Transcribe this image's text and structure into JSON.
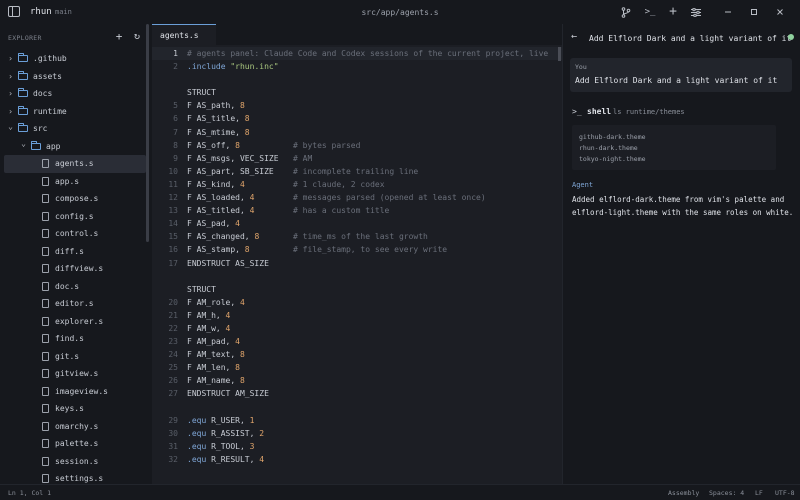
{
  "titlebar": {
    "app_name": "rhun",
    "branch": "main",
    "path": "src/app/agents.s",
    "icons": [
      "branch-icon",
      "terminal-icon",
      "plus-icon",
      "settings-sliders-icon",
      "minimize-icon",
      "maximize-icon",
      "close-icon"
    ]
  },
  "explorer": {
    "heading": "EXPLORER",
    "tree": [
      {
        "label": ".github",
        "kind": "folder",
        "depth": 0,
        "open": false
      },
      {
        "label": "assets",
        "kind": "folder",
        "depth": 0,
        "open": false
      },
      {
        "label": "docs",
        "kind": "folder",
        "depth": 0,
        "open": false
      },
      {
        "label": "runtime",
        "kind": "folder",
        "depth": 0,
        "open": false
      },
      {
        "label": "src",
        "kind": "folder",
        "depth": 0,
        "open": true
      },
      {
        "label": "app",
        "kind": "folder",
        "depth": 1,
        "open": true
      },
      {
        "label": "agents.s",
        "kind": "file",
        "depth": 2,
        "active": true
      },
      {
        "label": "app.s",
        "kind": "file",
        "depth": 2
      },
      {
        "label": "compose.s",
        "kind": "file",
        "depth": 2
      },
      {
        "label": "config.s",
        "kind": "file",
        "depth": 2
      },
      {
        "label": "control.s",
        "kind": "file",
        "depth": 2
      },
      {
        "label": "diff.s",
        "kind": "file",
        "depth": 2
      },
      {
        "label": "diffview.s",
        "kind": "file",
        "depth": 2
      },
      {
        "label": "doc.s",
        "kind": "file",
        "depth": 2
      },
      {
        "label": "editor.s",
        "kind": "file",
        "depth": 2
      },
      {
        "label": "explorer.s",
        "kind": "file",
        "depth": 2
      },
      {
        "label": "find.s",
        "kind": "file",
        "depth": 2
      },
      {
        "label": "git.s",
        "kind": "file",
        "depth": 2
      },
      {
        "label": "gitview.s",
        "kind": "file",
        "depth": 2
      },
      {
        "label": "imageview.s",
        "kind": "file",
        "depth": 2
      },
      {
        "label": "keys.s",
        "kind": "file",
        "depth": 2
      },
      {
        "label": "omarchy.s",
        "kind": "file",
        "depth": 2
      },
      {
        "label": "palette.s",
        "kind": "file",
        "depth": 2
      },
      {
        "label": "session.s",
        "kind": "file",
        "depth": 2
      },
      {
        "label": "settings.s",
        "kind": "file",
        "depth": 2
      }
    ]
  },
  "editor": {
    "tab_label": "agents.s",
    "lines": [
      {
        "n": "1",
        "segments": [
          [
            "cm",
            "# agents panel: Claude Code and Codex sessions of the current project, live"
          ]
        ],
        "current": true
      },
      {
        "n": "2",
        "segments": [
          [
            "dir",
            ".include "
          ],
          [
            "str",
            "\"rhun.inc\""
          ]
        ]
      },
      {
        "n": "",
        "segments": []
      },
      {
        "n": "",
        "segments": [
          [
            "txt",
            "STRUCT"
          ]
        ]
      },
      {
        "n": "5",
        "segments": [
          [
            "txt",
            "F AS_path, "
          ],
          [
            "num",
            "8"
          ]
        ]
      },
      {
        "n": "6",
        "segments": [
          [
            "txt",
            "F AS_title, "
          ],
          [
            "num",
            "8"
          ]
        ]
      },
      {
        "n": "7",
        "segments": [
          [
            "txt",
            "F AS_mtime, "
          ],
          [
            "num",
            "8"
          ]
        ]
      },
      {
        "n": "8",
        "segments": [
          [
            "txt",
            "F AS_off, "
          ],
          [
            "num",
            "8"
          ]
        ],
        "comment": "# bytes parsed"
      },
      {
        "n": "9",
        "segments": [
          [
            "txt",
            "F AS_msgs, VEC_SIZE"
          ]
        ],
        "comment": "# AM"
      },
      {
        "n": "10",
        "segments": [
          [
            "txt",
            "F AS_part, SB_SIZE"
          ]
        ],
        "comment": "# incomplete trailing line"
      },
      {
        "n": "11",
        "segments": [
          [
            "txt",
            "F AS_kind, "
          ],
          [
            "num",
            "4"
          ]
        ],
        "comment": "# 1 claude, 2 codex"
      },
      {
        "n": "12",
        "segments": [
          [
            "txt",
            "F AS_loaded, "
          ],
          [
            "num",
            "4"
          ]
        ],
        "comment": "# messages parsed (opened at least once)"
      },
      {
        "n": "13",
        "segments": [
          [
            "txt",
            "F AS_titled, "
          ],
          [
            "num",
            "4"
          ]
        ],
        "comment": "# has a custom title"
      },
      {
        "n": "14",
        "segments": [
          [
            "txt",
            "F AS_pad, "
          ],
          [
            "num",
            "4"
          ]
        ]
      },
      {
        "n": "15",
        "segments": [
          [
            "txt",
            "F AS_changed, "
          ],
          [
            "num",
            "8"
          ]
        ],
        "comment": "# time_ms of the last growth"
      },
      {
        "n": "16",
        "segments": [
          [
            "txt",
            "F AS_stamp, "
          ],
          [
            "num",
            "8"
          ]
        ],
        "comment": "# file_stamp, to see every write"
      },
      {
        "n": "17",
        "segments": [
          [
            "txt",
            "ENDSTRUCT AS_SIZE"
          ]
        ]
      },
      {
        "n": "",
        "segments": []
      },
      {
        "n": "",
        "segments": [
          [
            "txt",
            "STRUCT"
          ]
        ]
      },
      {
        "n": "20",
        "segments": [
          [
            "txt",
            "F AM_role, "
          ],
          [
            "num",
            "4"
          ]
        ]
      },
      {
        "n": "21",
        "segments": [
          [
            "txt",
            "F AM_h, "
          ],
          [
            "num",
            "4"
          ]
        ]
      },
      {
        "n": "22",
        "segments": [
          [
            "txt",
            "F AM_w, "
          ],
          [
            "num",
            "4"
          ]
        ]
      },
      {
        "n": "23",
        "segments": [
          [
            "txt",
            "F AM_pad, "
          ],
          [
            "num",
            "4"
          ]
        ]
      },
      {
        "n": "24",
        "segments": [
          [
            "txt",
            "F AM_text, "
          ],
          [
            "num",
            "8"
          ]
        ]
      },
      {
        "n": "25",
        "segments": [
          [
            "txt",
            "F AM_len, "
          ],
          [
            "num",
            "8"
          ]
        ]
      },
      {
        "n": "26",
        "segments": [
          [
            "txt",
            "F AM_name, "
          ],
          [
            "num",
            "8"
          ]
        ]
      },
      {
        "n": "27",
        "segments": [
          [
            "txt",
            "ENDSTRUCT AM_SIZE"
          ]
        ]
      },
      {
        "n": "",
        "segments": []
      },
      {
        "n": "29",
        "segments": [
          [
            "dir",
            ".equ "
          ],
          [
            "txt",
            "R_USER, "
          ],
          [
            "num",
            "1"
          ]
        ]
      },
      {
        "n": "30",
        "segments": [
          [
            "dir",
            ".equ "
          ],
          [
            "txt",
            "R_ASSIST, "
          ],
          [
            "num",
            "2"
          ]
        ]
      },
      {
        "n": "31",
        "segments": [
          [
            "dir",
            ".equ "
          ],
          [
            "txt",
            "R_TOOL, "
          ],
          [
            "num",
            "3"
          ]
        ]
      },
      {
        "n": "32",
        "segments": [
          [
            "dir",
            ".equ "
          ],
          [
            "txt",
            "R_RESULT, "
          ],
          [
            "num",
            "4"
          ]
        ]
      }
    ]
  },
  "agent": {
    "title": "Add Elflord Dark and a light variant of it",
    "you_label": "You",
    "you_message": "Add Elflord Dark and a light variant of it",
    "shell_label": "shell",
    "shell_command": "ls runtime/themes",
    "shell_output": [
      "github-dark.theme",
      "rhun-dark.theme",
      "tokyo-night.theme"
    ],
    "agent_label": "Agent",
    "agent_reply": "Added elflord-dark.theme from vim's palette and elflord-light.theme with the same roles on white.",
    "status_color": "#8fd19e"
  },
  "statusbar": {
    "cursor": "Ln 1, Col 1",
    "language": "Assembly",
    "indent": "Spaces: 4",
    "eol": "LF",
    "encoding": "UTF-8"
  },
  "colors": {
    "accent": "#6b9fd8",
    "background": "#16181d",
    "editor_background": "#1c1e24",
    "string": "#a9c77f",
    "number": "#e0a56b",
    "comment": "#6a6f7a"
  }
}
